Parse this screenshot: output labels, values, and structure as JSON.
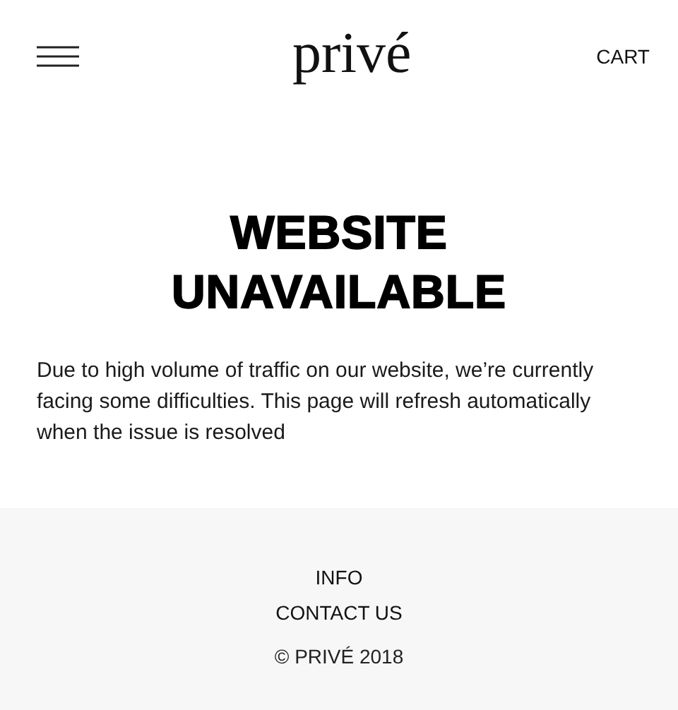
{
  "header": {
    "logo": "privé",
    "cart": "CART"
  },
  "message": {
    "title": [
      "WEBSITE",
      "UNAVAILABLE"
    ],
    "body": "Due to high volume of traffic on our website, we’re currently facing some difficulties. This page will refresh automatically when the issue is resolved"
  },
  "footer": {
    "links": [
      "INFO",
      "CONTACT US"
    ],
    "copyright": "© PRIVÉ 2018"
  }
}
